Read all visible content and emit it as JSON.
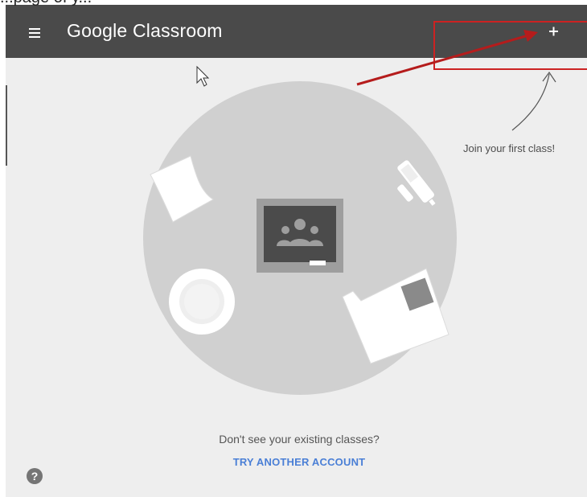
{
  "caption": "...page of y...",
  "appbar": {
    "title": "Google Classroom",
    "menu_icon": "hamburger-menu-icon",
    "add_icon": "plus-icon",
    "background": "#4a4a4a"
  },
  "annotation": {
    "hint": "Join your first class!",
    "highlight_color": "#cc2222"
  },
  "main": {
    "missing_text": "Don't see your existing classes?",
    "try_link": "TRY ANOTHER ACCOUNT",
    "link_color": "#4a7fd6",
    "help_icon": "help-icon",
    "help_glyph": "?"
  }
}
